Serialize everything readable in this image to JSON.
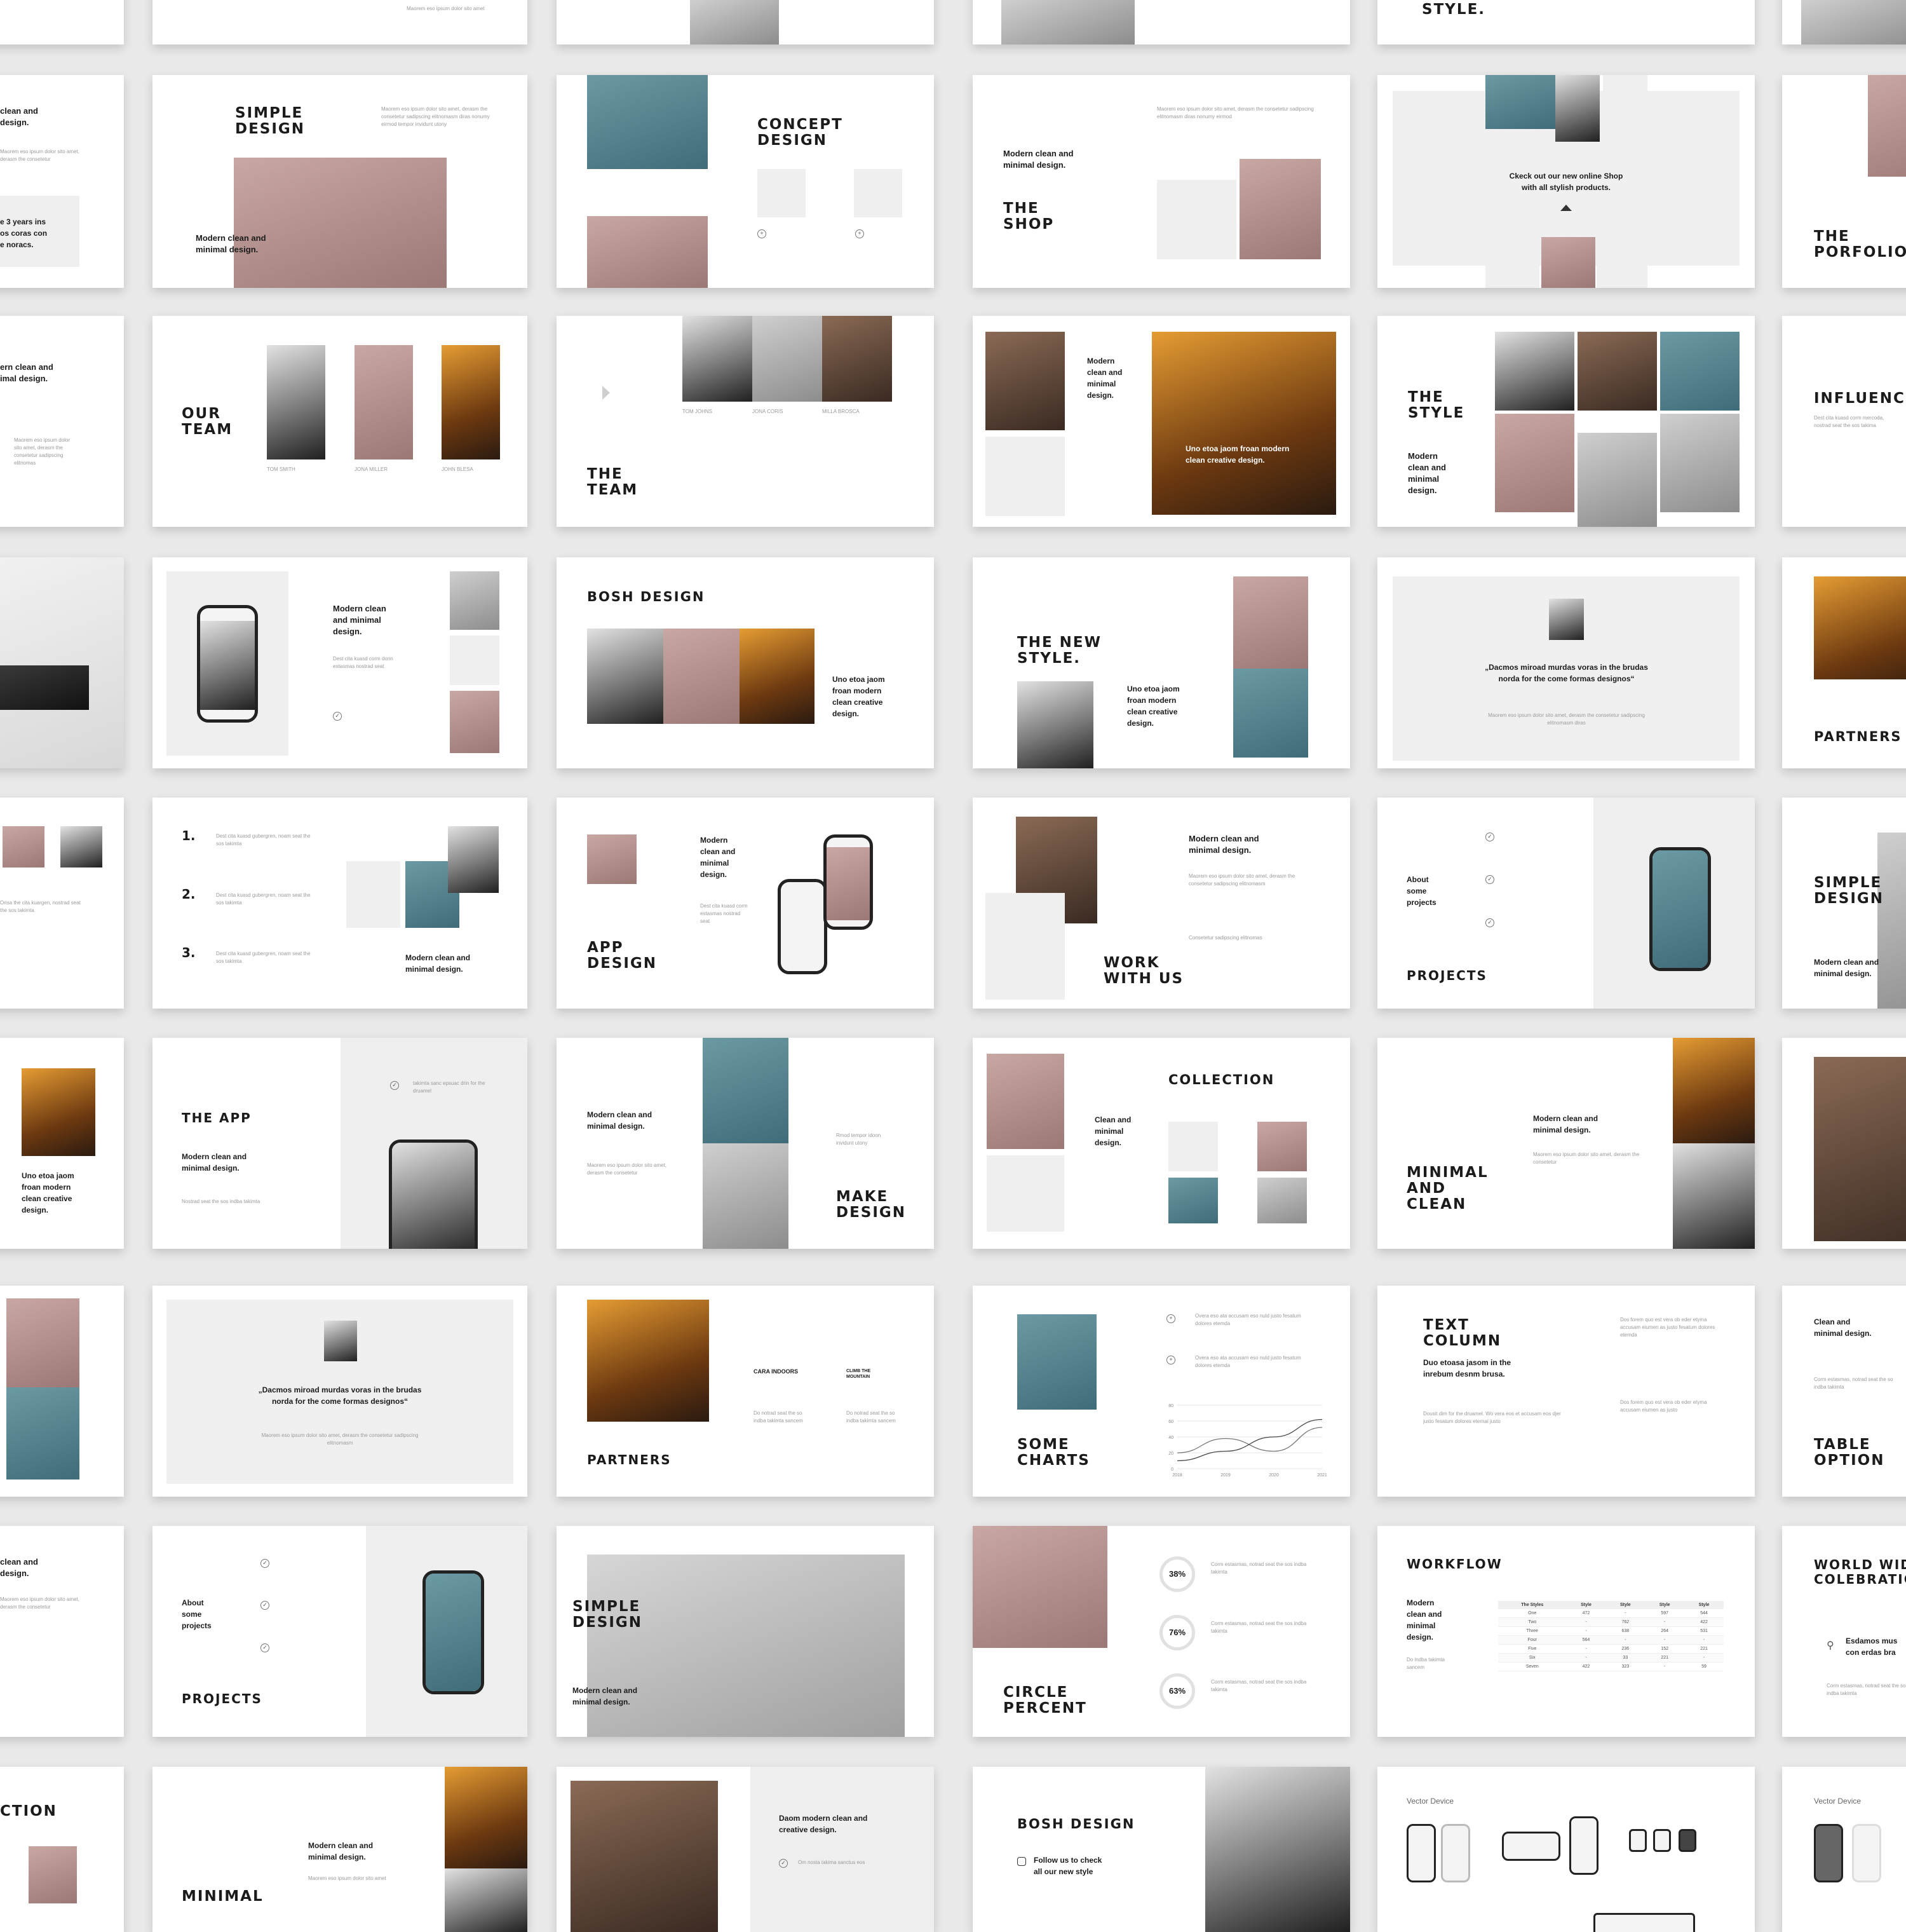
{
  "slides": {
    "r0c2": {
      "title": "STYLE."
    },
    "simple_design": {
      "title": "SIMPLE\nDESIGN",
      "sub": "Modern clean and\nminimal design."
    },
    "concept_design": {
      "title": "CONCEPT\nDESIGN"
    },
    "the_shop": {
      "title": "THE\nSHOP",
      "sub": "Modern clean and\nminimal design."
    },
    "shop_promo": {
      "text": "Ckeck out our new online Shop\nwith all stylish products."
    },
    "the_porfolio": {
      "title": "THE\nPORFOLIO"
    },
    "r1c0": {
      "sub": "clean and\ndesign.",
      "note": "e 3 years ins\nos coras con\ne noracs."
    },
    "our_team": {
      "title": "OUR\nTEAM",
      "names": [
        "TOM SMITH",
        "JONA MILLER",
        "JOHN BLESA"
      ]
    },
    "the_team": {
      "title": "THE\nTEAM",
      "names": [
        "TOM JOHNS",
        "JONA CORIS",
        "MILLA BROSCA"
      ]
    },
    "quote_photo": {
      "sub": "Modern\nclean and\nminimal\ndesign.",
      "caption": "Uno etoa jaom froan modern\nclean creative design."
    },
    "the_style": {
      "title": "THE\nSTYLE",
      "sub": "Modern\nclean and\nminimal\ndesign."
    },
    "influencer": {
      "title": "INFLUENCER"
    },
    "r2c0": {
      "sub": "ern clean and\nimal design."
    },
    "phone_minimal": {
      "sub": "Modern clean\nand minimal\ndesign."
    },
    "bosh_design": {
      "title": "BOSH DESIGN",
      "sub": "Uno etoa jaom\nfroan modern\nclean creative\ndesign."
    },
    "the_new_style": {
      "title": "THE NEW\nSTYLE.",
      "sub": "Uno etoa jaom\nfroan modern\nclean creative\ndesign."
    },
    "quote_card": {
      "quote": "„Dacmos miroad murdas voras in the brudas\nnorda for the come formas designos“"
    },
    "partners_side": {
      "title": "PARTNERS"
    },
    "numbers": {
      "items": [
        "1.",
        "2.",
        "3."
      ],
      "sub": "Modern clean and\nminimal design."
    },
    "app_design": {
      "title": "APP\nDESIGN",
      "sub": "Modern\nclean and\nminimal\ndesign."
    },
    "work_with_us": {
      "title": "WORK\nWITH US",
      "sub": "Modern clean and\nminimal design."
    },
    "projects": {
      "title": "PROJECTS",
      "sub": "About\nsome\nprojects"
    },
    "simple_design_side": {
      "title": "SIMPLE\nDESIGN",
      "sub": "Modern clean and\nminimal design."
    },
    "r5c0": {
      "sub": "Uno etoa jaom\nfroan modern\nclean creative\ndesign."
    },
    "the_app": {
      "title": "THE APP",
      "sub": "Modern clean and\nminimal design."
    },
    "make_design": {
      "title": "MAKE\nDESIGN",
      "sub": "Modern clean and\nminimal design."
    },
    "collection": {
      "title": "COLLECTION",
      "sub": "Clean and\nminimal\ndesign."
    },
    "minimal_and_clean": {
      "title": "MINIMAL\nAND\nCLEAN",
      "sub": "Modern clean and\nminimal design."
    },
    "quote_card_2": {
      "quote": "„Dacmos miroad murdas voras in the brudas\nnorda for the come formas designos“"
    },
    "partners": {
      "title": "PARTNERS",
      "logos": [
        "CARA INDOORS",
        "CLIMB THE MOUNTAIN"
      ]
    },
    "some_charts": {
      "title": "SOME\nCHARTS"
    },
    "text_column": {
      "title": "TEXT\nCOLUMN",
      "sub": "Duo etoasa jasom in the\ninrebum desnm brusa."
    },
    "table_option": {
      "title": "TABLE\nOPTION",
      "sub": "Clean and\nminimal design."
    },
    "r7c0": {
      "sub": "clean and\ndesign."
    },
    "projects_2": {
      "title": "PROJECTS",
      "sub": "About\nsome\nprojects"
    },
    "simple_design_leaf": {
      "title": "SIMPLE\nDESIGN",
      "sub": "Modern clean and\nminimal design."
    },
    "circle_percent": {
      "title": "CIRCLE\nPERCENT",
      "values": [
        "38%",
        "76%",
        "63%"
      ]
    },
    "workflow": {
      "title": "WORKFLOW",
      "sub": "Modern\nclean and\nminimal\ndesign."
    },
    "world_wide": {
      "title": "WORLD WID\nCOLEBRATIC",
      "sub": "Esdamos mus\ncon erdas bra"
    },
    "r8c0": {
      "title": "CTION"
    },
    "minimal_bottom": {
      "title": "MINIMAL",
      "sub": "Modern clean and\nminimal design."
    },
    "daom": {
      "sub": "Daom modern clean and\ncreative design."
    },
    "bosh_design_2": {
      "title": "BOSH DESIGN",
      "sub": "Follow us to check\nall our new style"
    },
    "vector_device": {
      "label": "Vector Device"
    },
    "vector_device_2": {
      "label": "Vector Device"
    }
  },
  "chart_data": {
    "type": "line",
    "categories": [
      "2018",
      "2019",
      "2020",
      "2021"
    ],
    "ylim": [
      0,
      80
    ],
    "yticks": [
      "80",
      "60",
      "40",
      "20",
      "0"
    ],
    "series": [
      {
        "values": [
          20,
          38,
          22,
          52
        ]
      },
      {
        "values": [
          10,
          22,
          40,
          62
        ]
      }
    ]
  },
  "table": {
    "headers": [
      "The Styles",
      "Style",
      "Style",
      "Style",
      "Style"
    ],
    "rows": [
      [
        "One",
        "472",
        "-",
        "597",
        "544"
      ],
      [
        "Two",
        "-",
        "762",
        "-",
        "422"
      ],
      [
        "Three",
        "-",
        "638",
        "264",
        "531"
      ],
      [
        "Four",
        "564",
        "-",
        "-",
        "-"
      ],
      [
        "Five",
        "-",
        "236",
        "152",
        "221"
      ],
      [
        "Six",
        "-",
        "33",
        "221",
        "-"
      ],
      [
        "Seven",
        "422",
        "323",
        "-",
        "59"
      ]
    ]
  }
}
